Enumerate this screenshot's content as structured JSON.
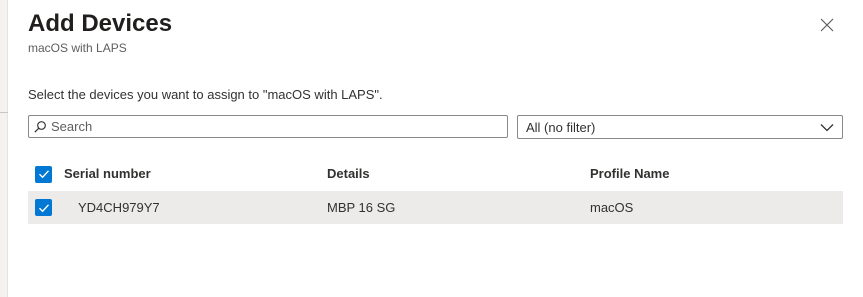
{
  "panel": {
    "title": "Add Devices",
    "subtitle": "macOS with LAPS",
    "close_icon": "close-icon"
  },
  "instruction": "Select the devices you want to assign to \"macOS with LAPS\".",
  "search": {
    "placeholder": "Search",
    "value": "",
    "icon": "search-icon"
  },
  "filter": {
    "selected": "All (no filter)",
    "icon": "chevron-down-icon"
  },
  "table": {
    "select_all_checked": true,
    "columns": [
      "Serial number",
      "Details",
      "Profile Name"
    ],
    "rows": [
      {
        "checked": true,
        "serial": "YD4CH979Y7",
        "details": "MBP 16 SG",
        "profile": "macOS"
      }
    ]
  },
  "colors": {
    "accent": "#0078d4",
    "selected_row_bg": "#edebe9",
    "text": "#323130",
    "muted_text": "#605e5c"
  }
}
